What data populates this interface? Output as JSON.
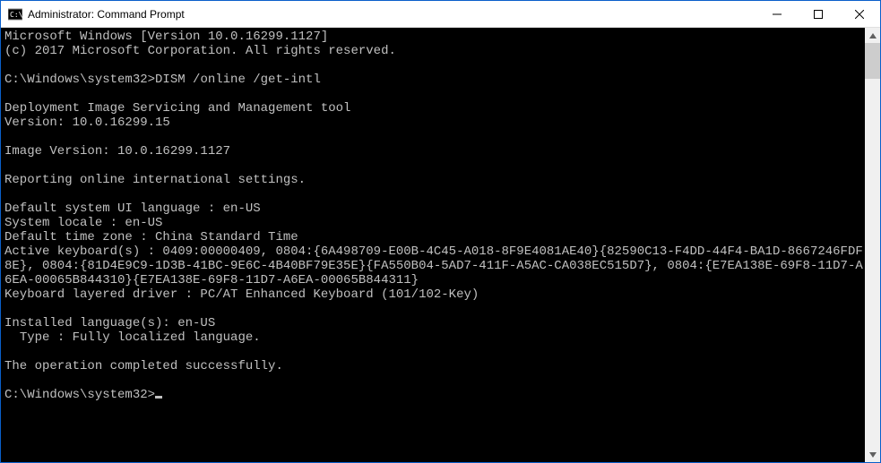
{
  "window": {
    "title": "Administrator: Command Prompt"
  },
  "terminal": {
    "line01": "Microsoft Windows [Version 10.0.16299.1127]",
    "line02": "(c) 2017 Microsoft Corporation. All rights reserved.",
    "blank03": "",
    "prompt1_path": "C:\\Windows\\system32>",
    "prompt1_cmd": "DISM /online /get-intl",
    "blank05": "",
    "line06": "Deployment Image Servicing and Management tool",
    "line07": "Version: 10.0.16299.15",
    "blank08": "",
    "line09": "Image Version: 10.0.16299.1127",
    "blank10": "",
    "line11": "Reporting online international settings.",
    "blank12": "",
    "line13": "Default system UI language : en-US",
    "line14": "System locale : en-US",
    "line15": "Default time zone : China Standard Time",
    "line16": "Active keyboard(s) : 0409:00000409, 0804:{6A498709-E00B-4C45-A018-8F9E4081AE40}{82590C13-F4DD-44F4-BA1D-8667246FDF8E}, 0804:{81D4E9C9-1D3B-41BC-9E6C-4B40BF79E35E}{FA550B04-5AD7-411F-A5AC-CA038EC515D7}, 0804:{E7EA138E-69F8-11D7-A6EA-00065B844310}{E7EA138E-69F8-11D7-A6EA-00065B844311}",
    "line17": "Keyboard layered driver : PC/AT Enhanced Keyboard (101/102-Key)",
    "blank18": "",
    "line19": "Installed language(s): en-US",
    "line20": "  Type : Fully localized language.",
    "blank21": "",
    "line22": "The operation completed successfully.",
    "blank23": "",
    "prompt2_path": "C:\\Windows\\system32>"
  }
}
